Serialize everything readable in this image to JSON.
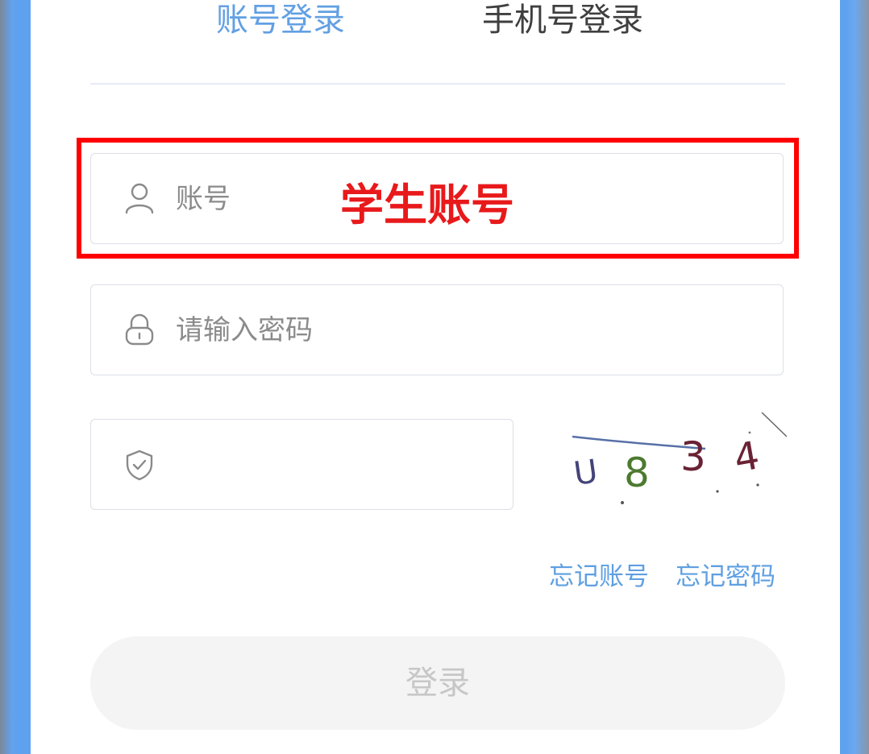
{
  "tabs": {
    "account": "账号登录",
    "phone": "手机号登录"
  },
  "form": {
    "account_placeholder": "账号",
    "password_placeholder": "请输入密码",
    "captcha_value": "",
    "captcha_image_text": "U834"
  },
  "annotation": {
    "label": "学生账号",
    "color": "#ff0000"
  },
  "links": {
    "forgot_account": "忘记账号",
    "forgot_password": "忘记密码"
  },
  "login_button": "登录",
  "icons": {
    "account": "user-icon",
    "password": "lock-icon",
    "captcha": "shield-check-icon"
  },
  "colors": {
    "accent": "#62a0e3",
    "frame": "#5ea1ef",
    "highlight": "#ff0000"
  }
}
